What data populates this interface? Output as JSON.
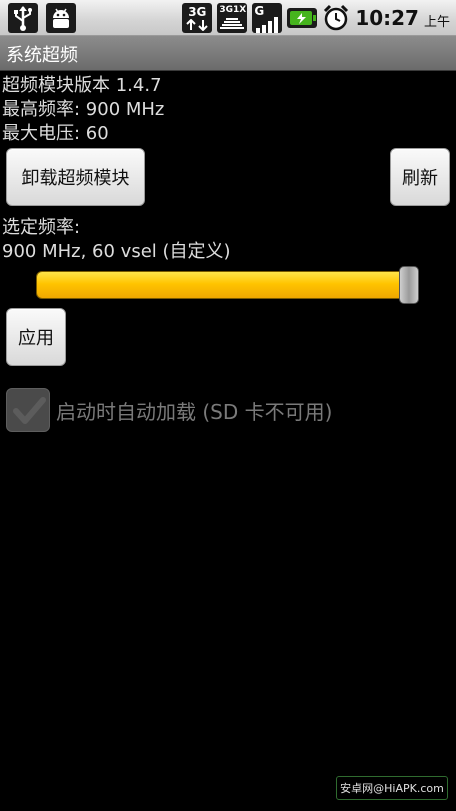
{
  "status_bar": {
    "icons_left": [
      "usb-icon",
      "android-debug-icon"
    ],
    "network_3g": "3G",
    "network_3g1x": [
      "3G",
      "1X"
    ],
    "network_g": "G",
    "battery_color": "#46b41e",
    "time": "10:27",
    "ampm": "上午"
  },
  "title_bar": {
    "title": "系统超频"
  },
  "info": {
    "module_version": "超频模块版本 1.4.7",
    "max_freq": "最高频率: 900 MHz",
    "max_voltage": "最大电压: 60"
  },
  "buttons": {
    "unload": "卸载超频模块",
    "refresh": "刷新",
    "apply": "应用"
  },
  "selected": {
    "label": "选定频率:",
    "value": "900 MHz, 60 vsel (自定义)",
    "slider_fraction": 1.0
  },
  "autoload": {
    "label": "启动时自动加载 (SD 卡不可用)",
    "checked": false,
    "enabled": false
  },
  "watermark": {
    "text": "安卓网@HiAPK.com"
  },
  "colors": {
    "slider": "#ffc400",
    "background": "#000000"
  }
}
